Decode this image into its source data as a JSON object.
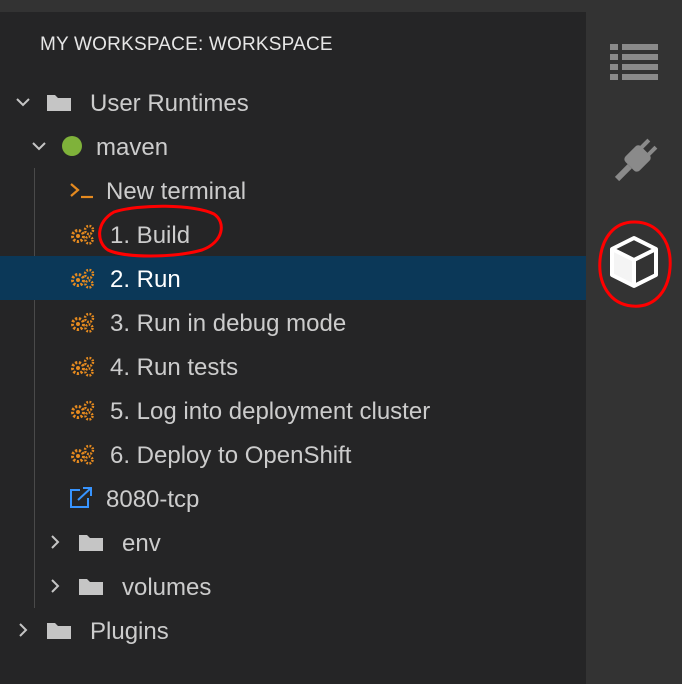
{
  "panel": {
    "title": "MY WORKSPACE: WORKSPACE"
  },
  "tree": {
    "user_runtimes": "User Runtimes",
    "maven": "maven",
    "new_terminal": "New terminal",
    "commands": [
      "1. Build",
      "2. Run",
      "3. Run in debug mode",
      "4. Run tests",
      "5. Log into deployment cluster",
      "6. Deploy to OpenShift"
    ],
    "endpoint": "8080-tcp",
    "env": "env",
    "volumes": "volumes",
    "plugins": "Plugins",
    "terminal_prompt_glyph": ">_"
  },
  "activity_bar": {
    "icons": [
      "list-icon",
      "plug-icon",
      "cube-icon"
    ]
  },
  "colors": {
    "selection": "#0b3858",
    "gear": "#e58a1f",
    "runtime_dot": "#7fb23a",
    "link_icon": "#3794ff",
    "annotation": "#ff0000"
  }
}
